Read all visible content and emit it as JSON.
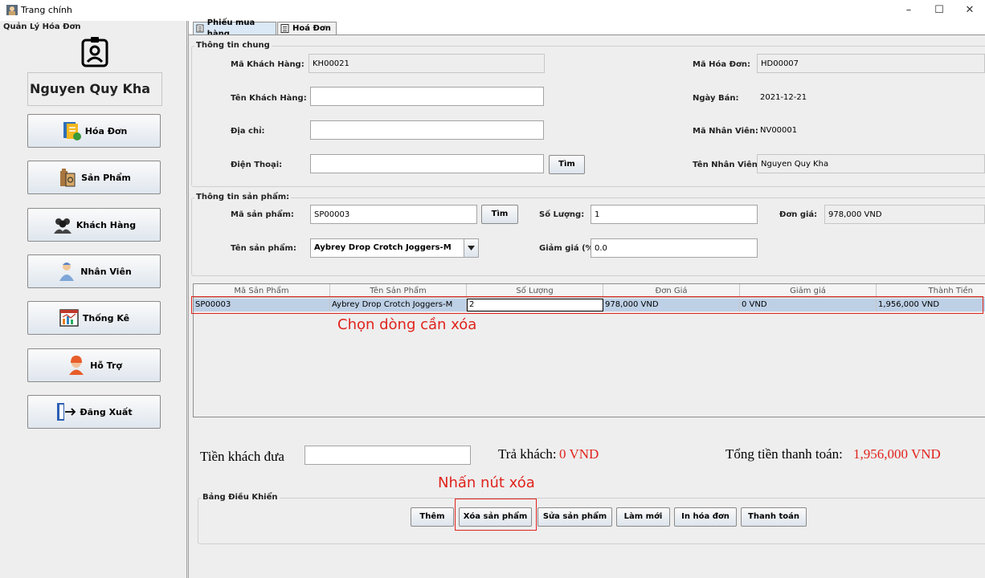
{
  "window": {
    "title": "Trang chính",
    "controls": {
      "minimize": "–",
      "maximize": "☐",
      "close": "✕"
    }
  },
  "sidebar": {
    "title": "Quản Lý Hóa Đơn",
    "user_name": "Nguyen Quy Kha",
    "items": [
      {
        "label": "Hóa Đơn",
        "icon": "invoice-icon"
      },
      {
        "label": "Sản Phẩm",
        "icon": "product-icon"
      },
      {
        "label": "Khách Hàng",
        "icon": "customers-icon"
      },
      {
        "label": "Nhân Viên",
        "icon": "employee-icon"
      },
      {
        "label": "Thống Kê",
        "icon": "statistics-icon"
      },
      {
        "label": "Hỗ Trợ",
        "icon": "support-icon"
      },
      {
        "label": "Đăng Xuất",
        "icon": "logout-icon"
      }
    ]
  },
  "tabs": [
    {
      "label": "Phiếu mua hàng",
      "active": true
    },
    {
      "label": "Hoá Đơn",
      "active": false
    }
  ],
  "general": {
    "title": "Thông tin chung",
    "customer_id_label": "Mã Khách Hàng:",
    "customer_id": "KH00021",
    "customer_name_label": "Tên Khách Hàng:",
    "customer_name": "",
    "address_label": "Địa chỉ:",
    "address": "",
    "phone_label": "Điện Thoại:",
    "phone": "",
    "search_button": "Tìm",
    "invoice_id_label": "Mã Hóa Đơn:",
    "invoice_id": "HD00007",
    "sale_date_label": "Ngày Bán:",
    "sale_date": "2021-12-21",
    "employee_id_label": "Mã Nhân Viên:",
    "employee_id": "NV00001",
    "employee_name_label": "Tên Nhân Viên:",
    "employee_name": "Nguyen Quy Kha"
  },
  "product": {
    "title": "Thông tin sản phẩm:",
    "product_id_label": "Mã sản phẩm:",
    "product_id": "SP00003",
    "search_button": "Tìm",
    "quantity_label": "Số Lượng:",
    "quantity": "1",
    "unit_price_label": "Đơn giá:",
    "unit_price": "978,000 VND",
    "product_name_label": "Tên sản phẩm:",
    "product_name": "Aybrey Drop Crotch Joggers-M",
    "discount_label": "Giảm giá (%):",
    "discount": "0.0"
  },
  "table": {
    "columns": [
      "Mã Sản Phẩm",
      "Tên Sản Phẩm",
      "Số Lượng",
      "Đơn Giá",
      "Giảm giá",
      "Thành Tiền"
    ],
    "rows": [
      [
        "SP00003",
        "Aybrey Drop Crotch Joggers-M",
        "2",
        "978,000 VND",
        "0 VND",
        "1,956,000 VND"
      ]
    ]
  },
  "annotations": {
    "select_row": "Chọn dòng cần xóa",
    "press_delete": "Nhấn nút xóa"
  },
  "payment": {
    "cash_label": "Tiền khách đưa",
    "cash_value": "",
    "change_label": "Trả khách:",
    "change_value": "0 VND",
    "total_label": "Tổng tiền thanh toán:",
    "total_value": "1,956,000 VND"
  },
  "controls": {
    "title": "Bảng Điều Khiển",
    "add": "Thêm",
    "delete": "Xóa sản phẩm",
    "edit": "Sửa sản phẩm",
    "refresh": "Làm mới",
    "print": "In hóa đơn",
    "pay": "Thanh toán"
  },
  "colors": {
    "annotation_red": "#e0231c",
    "selected_row": "#bdd0e6",
    "active_tab": "#dbe8f6"
  }
}
